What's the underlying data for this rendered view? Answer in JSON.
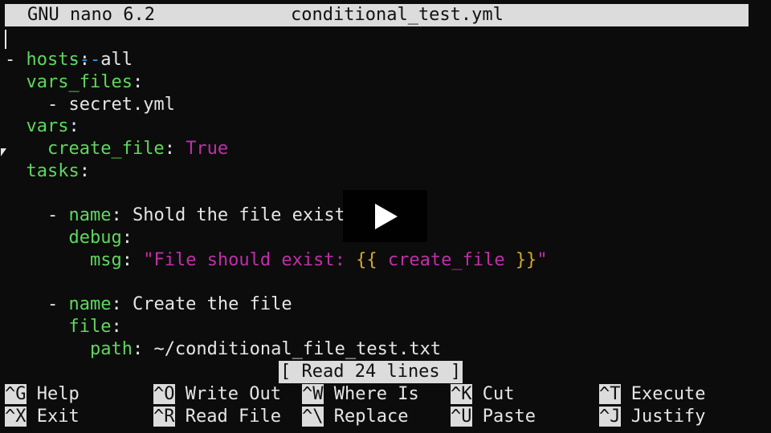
{
  "titlebar": {
    "version": "GNU nano 6.2",
    "filename": "conditional_test.yml"
  },
  "editor": {
    "doc_marker": "---",
    "lines": {
      "l2_dash": "- ",
      "l2_key": "hosts",
      "l2_val": ": all",
      "l3_key": "vars_files",
      "l3_colon": ":",
      "l4_text": "- secret.yml",
      "l5_key": "vars",
      "l5_colon": ":",
      "l6_key": "create_file",
      "l6_colon": ": ",
      "l6_val": "True",
      "l7_key": "tasks",
      "l7_colon": ":",
      "l9_dash": "- ",
      "l9_key": "name",
      "l9_val": ": Shold the file exist",
      "l10_key": "debug",
      "l10_colon": ":",
      "l11_key": "msg",
      "l11_colon": ": ",
      "l11_str1": "\"File should exist: ",
      "l11_brace_open": "{{",
      "l11_var": " create_file ",
      "l11_brace_close": "}}",
      "l11_str2": "\"",
      "l13_dash": "- ",
      "l13_key": "name",
      "l13_val": ": Create the file",
      "l14_key": "file",
      "l14_colon": ":",
      "l15_key": "path",
      "l15_val": ": ~/conditional_file_test.txt"
    }
  },
  "status": {
    "message": "[ Read 24 lines ]"
  },
  "shortcuts": [
    {
      "key": "^G",
      "label": "Help"
    },
    {
      "key": "^O",
      "label": "Write Out"
    },
    {
      "key": "^W",
      "label": "Where Is"
    },
    {
      "key": "^K",
      "label": "Cut"
    },
    {
      "key": "^T",
      "label": "Execute"
    },
    {
      "key": "^X",
      "label": "Exit"
    },
    {
      "key": "^R",
      "label": "Read File"
    },
    {
      "key": "^\\",
      "label": "Replace"
    },
    {
      "key": "^U",
      "label": "Paste"
    },
    {
      "key": "^J",
      "label": "Justify"
    }
  ]
}
